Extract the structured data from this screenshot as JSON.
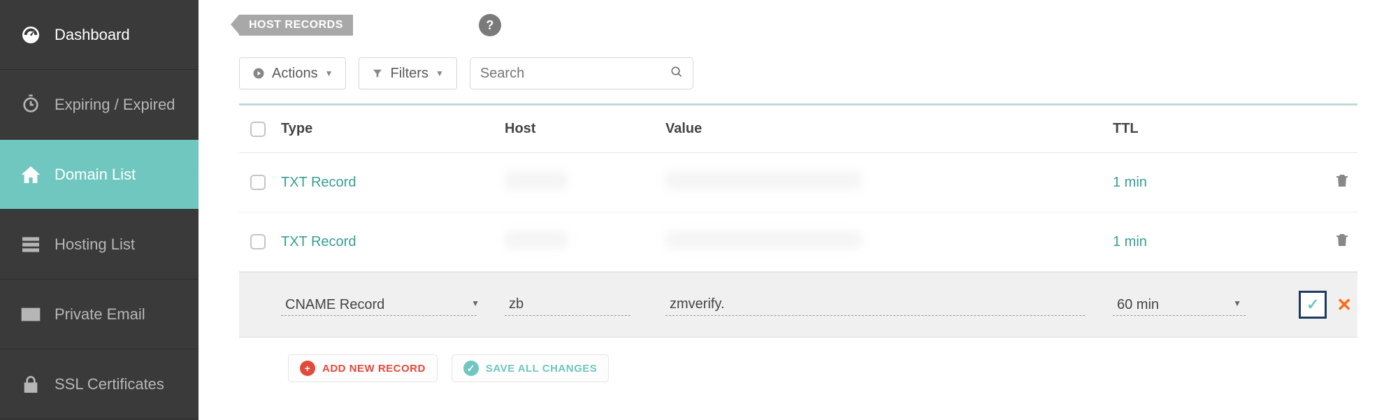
{
  "sidebar": {
    "items": [
      {
        "label": "Dashboard",
        "icon": "gauge-icon"
      },
      {
        "label": "Expiring / Expired",
        "icon": "stopwatch-icon"
      },
      {
        "label": "Domain List",
        "icon": "house-icon"
      },
      {
        "label": "Hosting List",
        "icon": "server-icon"
      },
      {
        "label": "Private Email",
        "icon": "envelope-icon"
      },
      {
        "label": "SSL Certificates",
        "icon": "lock-icon"
      }
    ],
    "active_index": 2
  },
  "section": {
    "tag": "HOST RECORDS"
  },
  "controls": {
    "actions_label": "Actions",
    "filters_label": "Filters",
    "search_placeholder": "Search"
  },
  "table": {
    "columns": {
      "type": "Type",
      "host": "Host",
      "value": "Value",
      "ttl": "TTL"
    },
    "rows": [
      {
        "type": "TXT Record",
        "host": "",
        "value": "",
        "ttl": "1 min"
      },
      {
        "type": "TXT Record",
        "host": "",
        "value": "",
        "ttl": "1 min"
      }
    ]
  },
  "edit": {
    "type": "CNAME Record",
    "host": "zb",
    "value": "zmverify.",
    "ttl": "60 min"
  },
  "footer": {
    "add_label": "ADD NEW RECORD",
    "save_label": "SAVE ALL CHANGES"
  }
}
